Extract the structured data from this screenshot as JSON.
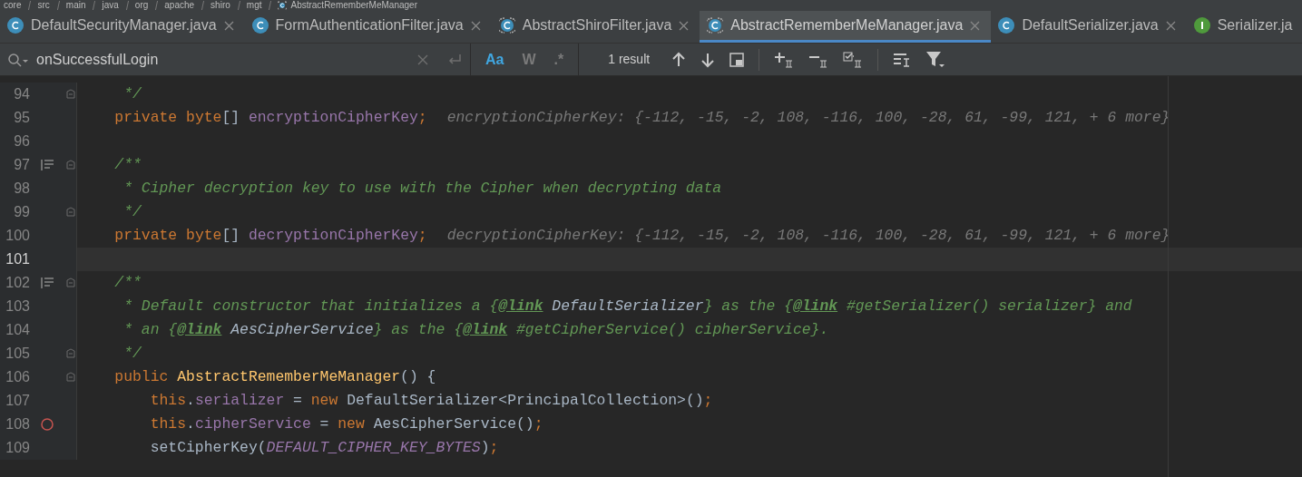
{
  "breadcrumb": [
    {
      "text": "core",
      "kind": "folder"
    },
    {
      "text": "src",
      "kind": "folder"
    },
    {
      "text": "main",
      "kind": "folder"
    },
    {
      "text": "java",
      "kind": "folder"
    },
    {
      "text": "org",
      "kind": "folder"
    },
    {
      "text": "apache",
      "kind": "folder"
    },
    {
      "text": "shiro",
      "kind": "folder"
    },
    {
      "text": "mgt",
      "kind": "folder"
    },
    {
      "text": "AbstractRememberMeManager",
      "kind": "class"
    }
  ],
  "tabs": [
    {
      "label": "DefaultSecurityManager.java",
      "kind": "class",
      "selected": false,
      "closable": true
    },
    {
      "label": "FormAuthenticationFilter.java",
      "kind": "class",
      "selected": false,
      "closable": true
    },
    {
      "label": "AbstractShiroFilter.java",
      "kind": "abstract",
      "selected": false,
      "closable": true
    },
    {
      "label": "AbstractRememberMeManager.java",
      "kind": "abstract",
      "selected": true,
      "closable": true
    },
    {
      "label": "DefaultSerializer.java",
      "kind": "class",
      "selected": false,
      "closable": true
    },
    {
      "label": "Serializer.ja",
      "kind": "interface",
      "selected": false,
      "closable": false
    }
  ],
  "search": {
    "value": "onSuccessfulLogin",
    "result": "1 result",
    "options": [
      {
        "label": "Aa",
        "selected": true
      },
      {
        "label": "W",
        "selected": false
      },
      {
        "label": ".*",
        "selected": false
      }
    ]
  },
  "lines": [
    {
      "number": "94",
      "fold": true,
      "current": false,
      "tokens": [
        {
          "text": "     */",
          "kind": "comment"
        }
      ]
    },
    {
      "number": "95",
      "fold": false,
      "current": false,
      "tokens": [
        {
          "text": "    private ",
          "kind": "keyword"
        },
        {
          "text": "byte",
          "kind": "keyword"
        },
        {
          "text": "[] ",
          "kind": "plain"
        },
        {
          "text": "encryptionCipherKey",
          "kind": "field"
        },
        {
          "text": ";",
          "kind": "keyword"
        }
      ],
      "hint": "encryptionCipherKey: {-112, -15, -2, 108, -116, 100, -28, 61, -99, 121, + 6 more}"
    },
    {
      "number": "96",
      "fold": false,
      "current": false
    },
    {
      "number": "97",
      "fold": true,
      "doc_comment": true,
      "current": false,
      "tokens": [
        {
          "text": "    /**",
          "kind": "comment"
        }
      ]
    },
    {
      "number": "98",
      "fold": false,
      "current": false,
      "tokens": [
        {
          "text": "     * Cipher decryption key to use with the Cipher when decrypting data",
          "kind": "comment"
        }
      ]
    },
    {
      "number": "99",
      "fold": true,
      "current": false,
      "tokens": [
        {
          "text": "     */",
          "kind": "comment"
        }
      ]
    },
    {
      "number": "100",
      "fold": false,
      "current": false,
      "tokens": [
        {
          "text": "    private ",
          "kind": "keyword"
        },
        {
          "text": "byte",
          "kind": "keyword"
        },
        {
          "text": "[] ",
          "kind": "plain"
        },
        {
          "text": "decryptionCipherKey",
          "kind": "field"
        },
        {
          "text": ";",
          "kind": "keyword"
        }
      ],
      "hint": "decryptionCipherKey: {-112, -15, -2, 108, -116, 100, -28, 61, -99, 121, + 6 more}"
    },
    {
      "number": "101",
      "fold": false,
      "current": true
    },
    {
      "number": "102",
      "fold": true,
      "doc_comment": true,
      "current": false,
      "tokens": [
        {
          "text": "    /**",
          "kind": "comment"
        }
      ]
    },
    {
      "number": "103",
      "fold": false,
      "current": false,
      "tokens": [
        {
          "text": "     * Default constructor that initializes a {",
          "kind": "comment"
        },
        {
          "text": "@link",
          "kind": "doctag"
        },
        {
          "text": " DefaultSerializer",
          "kind": "docref"
        },
        {
          "text": "} as the {",
          "kind": "comment"
        },
        {
          "text": "@link",
          "kind": "doctag"
        },
        {
          "text": " #getSerializer() serializer} and",
          "kind": "comment"
        }
      ]
    },
    {
      "number": "104",
      "fold": false,
      "current": false,
      "tokens": [
        {
          "text": "     * an {",
          "kind": "comment"
        },
        {
          "text": "@link",
          "kind": "doctag"
        },
        {
          "text": " AesCipherService",
          "kind": "docref"
        },
        {
          "text": "} as the {",
          "kind": "comment"
        },
        {
          "text": "@link",
          "kind": "doctag"
        },
        {
          "text": " #getCipherService() cipherService}.",
          "kind": "comment"
        }
      ]
    },
    {
      "number": "105",
      "fold": true,
      "current": false,
      "tokens": [
        {
          "text": "     */",
          "kind": "comment"
        }
      ]
    },
    {
      "number": "106",
      "fold": true,
      "current": false,
      "tokens": [
        {
          "text": "    public ",
          "kind": "keyword"
        },
        {
          "text": "AbstractRememberMeManager",
          "kind": "method"
        },
        {
          "text": "() {",
          "kind": "plain"
        }
      ]
    },
    {
      "number": "107",
      "fold": false,
      "current": false,
      "tokens": [
        {
          "text": "        this",
          "kind": "keyword"
        },
        {
          "text": ".",
          "kind": "plain"
        },
        {
          "text": "serializer",
          "kind": "field"
        },
        {
          "text": " = ",
          "kind": "plain"
        },
        {
          "text": "new ",
          "kind": "keyword"
        },
        {
          "text": "DefaultSerializer<PrincipalCollection>()",
          "kind": "plain"
        },
        {
          "text": ";",
          "kind": "keyword"
        }
      ]
    },
    {
      "number": "108",
      "fold": false,
      "breakpoint": true,
      "current": false,
      "tokens": [
        {
          "text": "        this",
          "kind": "keyword"
        },
        {
          "text": ".",
          "kind": "plain"
        },
        {
          "text": "cipherService",
          "kind": "field"
        },
        {
          "text": " = ",
          "kind": "plain"
        },
        {
          "text": "new ",
          "kind": "keyword"
        },
        {
          "text": "AesCipherService()",
          "kind": "plain"
        },
        {
          "text": ";",
          "kind": "keyword"
        }
      ]
    },
    {
      "number": "109",
      "fold": false,
      "current": false,
      "tokens": [
        {
          "text": "        setCipherKey(",
          "kind": "plain"
        },
        {
          "text": "DEFAULT_CIPHER_KEY_BYTES",
          "kind": "constant"
        },
        {
          "text": ")",
          "kind": "plain"
        },
        {
          "text": ";",
          "kind": "keyword"
        }
      ]
    }
  ]
}
